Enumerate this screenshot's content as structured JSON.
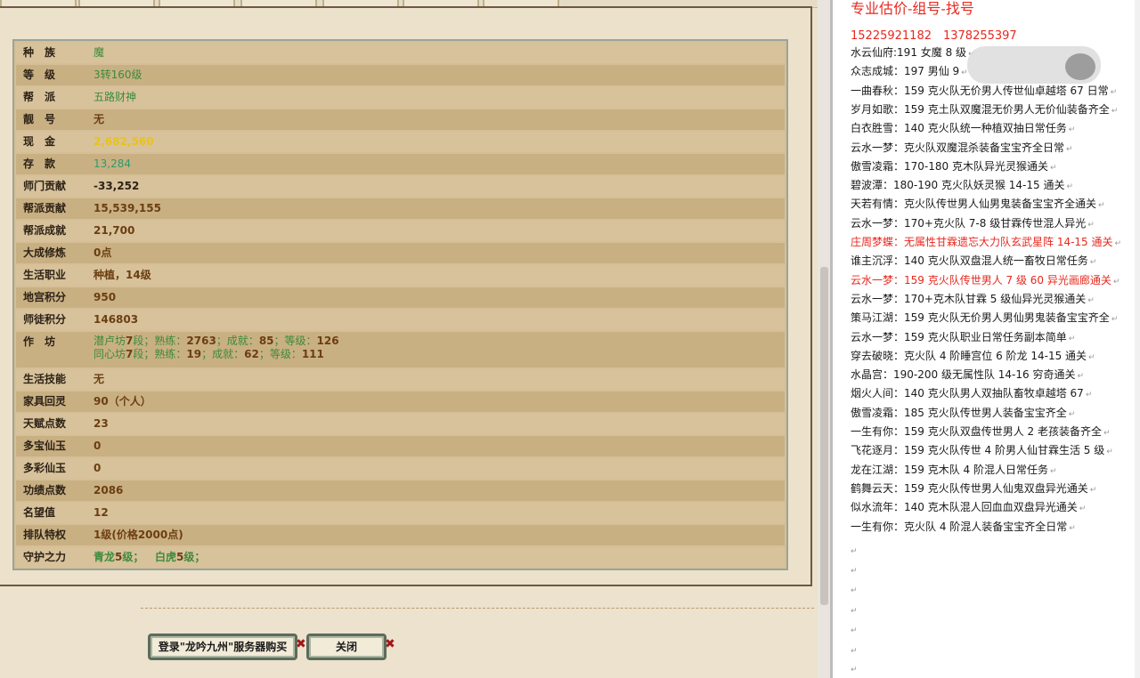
{
  "rows": [
    {
      "label": "种　族",
      "value": "魔",
      "style": "green"
    },
    {
      "label": "等　级",
      "value": "3转160级",
      "style": "green"
    },
    {
      "label": "帮　派",
      "value": "五路财神",
      "style": "green"
    },
    {
      "label": "靓　号",
      "value": "无",
      "style": "brown"
    },
    {
      "label": "现　金",
      "value": "2,682,560",
      "style": "gold"
    },
    {
      "label": "存　款",
      "value": "13,284",
      "style": "teal"
    },
    {
      "label": "师门贡献",
      "value": "-33,252",
      "style": "dark"
    },
    {
      "label": "帮派贡献",
      "value": "15,539,155",
      "style": "brown"
    },
    {
      "label": "帮派成就",
      "value": "21,700",
      "style": "brown"
    },
    {
      "label": "大成修炼",
      "value": "0点",
      "style": "brown"
    },
    {
      "label": "生活职业",
      "value": "种植，14级",
      "style": "brown"
    },
    {
      "label": "地宫积分",
      "value": "950",
      "style": "brown"
    },
    {
      "label": "师徒积分",
      "value": "146803",
      "style": "brown"
    },
    {
      "label": "作　坊",
      "value": "",
      "style": "brown"
    },
    {
      "label": "生活技能",
      "value": "无",
      "style": "brown"
    },
    {
      "label": "家具回灵",
      "value": "90（个人）",
      "style": "brown"
    },
    {
      "label": "天赋点数",
      "value": "23",
      "style": "brown"
    },
    {
      "label": "多宝仙玉",
      "value": "0",
      "style": "brown"
    },
    {
      "label": "多彩仙玉",
      "value": "0",
      "style": "brown"
    },
    {
      "label": "功绩点数",
      "value": "2086",
      "style": "brown"
    },
    {
      "label": "名望值",
      "value": "12",
      "style": "brown"
    },
    {
      "label": "排队特权",
      "value": "1级(价格2000点)",
      "style": "brown"
    },
    {
      "label": "守护之力",
      "value": "",
      "style": "green"
    }
  ],
  "workshop": {
    "line1": {
      "name": "潜卢坊",
      "lv": "7",
      "t1": "段；熟练：",
      "f": "2763",
      "t2": "；成就：",
      "a": "85",
      "t3": "；等级：",
      "g": "126"
    },
    "line2": {
      "name": "同心坊",
      "lv": "7",
      "t1": "段；熟练：",
      "f": "19",
      "t2": "；成就：",
      "a": "62",
      "t3": "；等级：",
      "g": "111"
    }
  },
  "guard": {
    "a_name": "青龙",
    "a_lv": "5",
    "a_suffix": "级；",
    "b_name": "白虎",
    "b_lv": "5",
    "b_suffix": "级；"
  },
  "buttons": {
    "login": "登录\"龙吟九州\"服务器购买",
    "close": "关闭"
  },
  "right": {
    "title": "专业估价-组号-找号",
    "phones": "15225921182　1378255397",
    "lines": [
      {
        "text": "水云仙府:191 女魔 8 级",
        "red": false
      },
      {
        "text": "众志成城：197 男仙 9",
        "red": false
      },
      {
        "text": "一曲春秋：159 克火队无价男人传世仙卓越塔 67 日常",
        "red": false
      },
      {
        "text": "岁月如歌：159 克土队双魔混无价男人无价仙装备齐全",
        "red": false
      },
      {
        "text": "白衣胜雪：140 克火队统一种植双抽日常任务",
        "red": false
      },
      {
        "text": "云水一梦：克火队双魔混杀装备宝宝齐全日常",
        "red": false
      },
      {
        "text": "傲雪凌霜：170-180 克木队异光灵猴通关",
        "red": false
      },
      {
        "text": "碧波潭：180-190 克火队妖灵猴 14-15 通关",
        "red": false
      },
      {
        "text": "天若有情：克火队传世男人仙男鬼装备宝宝齐全通关",
        "red": false
      },
      {
        "text": "云水一梦：170+克火队 7-8 级甘霖传世混人异光",
        "red": false
      },
      {
        "text": "庄周梦蝶：无属性甘霖遗忘大力队玄武星阵 14-15 通关",
        "red": true
      },
      {
        "text": "谁主沉浮：140 克火队双盘混人统一畜牧日常任务",
        "red": false
      },
      {
        "text": "云水一梦：159 克火队传世男人 7 级 60 异光画廊通关",
        "red": true
      },
      {
        "text": "云水一梦：170+克木队甘霖 5 级仙异光灵猴通关",
        "red": false
      },
      {
        "text": "策马江湖：159 克火队无价男人男仙男鬼装备宝宝齐全",
        "red": false
      },
      {
        "text": "云水一梦：159 克火队职业日常任务副本简单",
        "red": false
      },
      {
        "text": "穿去破晓：克火队 4 阶睡宫位 6 阶龙 14-15 通关",
        "red": false
      },
      {
        "text": "水晶宫：190-200 级无属性队 14-16 穷奇通关",
        "red": false
      },
      {
        "text": "烟火人间：140 克火队男人双抽队畜牧卓越塔 67",
        "red": false
      },
      {
        "text": "傲雪凌霜：185 克火队传世男人装备宝宝齐全",
        "red": false
      },
      {
        "text": "一生有你：159 克火队双盘传世男人 2 老孩装备齐全",
        "red": false
      },
      {
        "text": "飞花逐月：159 克火队传世 4 阶男人仙甘霖生活 5 级",
        "red": false
      },
      {
        "text": "龙在江湖：159 克木队 4 阶混人日常任务",
        "red": false
      },
      {
        "text": "鹤舞云天：159 克火队传世男人仙鬼双盘异光通关",
        "red": false
      },
      {
        "text": "似水流年：140 克木队混人回血血双盘异光通关",
        "red": false
      },
      {
        "text": "一生有你：克火队 4 阶混人装备宝宝齐全日常",
        "red": false
      }
    ],
    "para_mark": "↵"
  }
}
